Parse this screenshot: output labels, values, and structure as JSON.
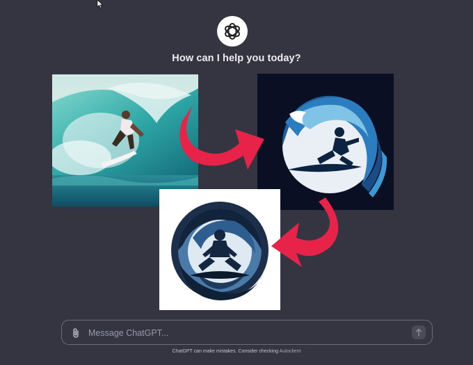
{
  "header": {
    "heading": "How can I help you today?",
    "logo_icon": "openai-logo-icon"
  },
  "gallery": {
    "images": [
      {
        "id": "photo",
        "subject": "surfer in wave photo"
      },
      {
        "id": "dark",
        "subject": "surfer wave logo on dark background"
      },
      {
        "id": "light",
        "subject": "surfer wave logo on white background"
      }
    ],
    "arrow_color": "#e8234a"
  },
  "composer": {
    "placeholder": "Message ChatGPT...",
    "attach_icon": "paperclip-icon",
    "send_icon": "arrow-up-icon"
  },
  "footer": {
    "disclaimer": "ChatGPT can make mistakes. Consider checking",
    "disclaimer_link": "Autoclient"
  },
  "colors": {
    "background": "#343541",
    "text": "#ececf1",
    "border": "#6b6c7b"
  }
}
